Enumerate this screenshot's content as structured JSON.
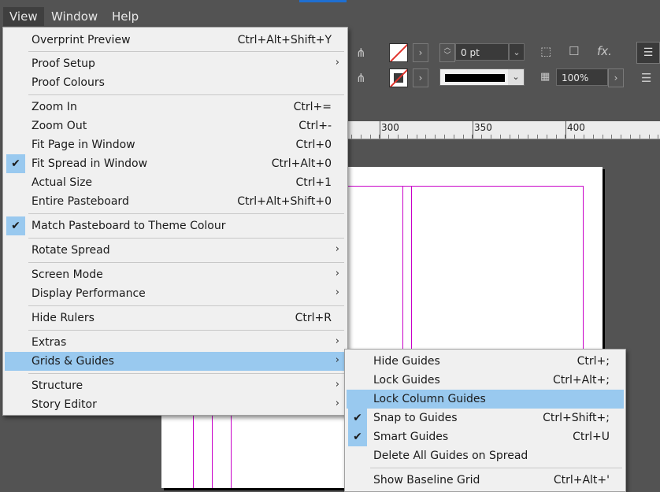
{
  "menubar": {
    "items": [
      "View",
      "Window",
      "Help"
    ]
  },
  "control_bar": {
    "stroke_weight": "0 pt",
    "opacity": "100%"
  },
  "ruler": {
    "labels": [
      "300",
      "350",
      "400"
    ]
  },
  "view_menu": {
    "items": [
      {
        "label": "Overprint Preview",
        "shortcut": "Ctrl+Alt+Shift+Y"
      },
      {
        "label": "Proof Setup",
        "submenu": true
      },
      {
        "label": "Proof Colours"
      },
      {
        "label": "Zoom In",
        "shortcut": "Ctrl+="
      },
      {
        "label": "Zoom Out",
        "shortcut": "Ctrl+-"
      },
      {
        "label": "Fit Page in Window",
        "shortcut": "Ctrl+0"
      },
      {
        "label": "Fit Spread in Window",
        "shortcut": "Ctrl+Alt+0",
        "checked": true
      },
      {
        "label": "Actual Size",
        "shortcut": "Ctrl+1"
      },
      {
        "label": "Entire Pasteboard",
        "shortcut": "Ctrl+Alt+Shift+0"
      },
      {
        "label": "Match Pasteboard to Theme Colour",
        "checked": true
      },
      {
        "label": "Rotate Spread",
        "submenu": true
      },
      {
        "label": "Screen Mode",
        "submenu": true
      },
      {
        "label": "Display Performance",
        "submenu": true
      },
      {
        "label": "Hide Rulers",
        "shortcut": "Ctrl+R"
      },
      {
        "label": "Extras",
        "submenu": true
      },
      {
        "label": "Grids & Guides",
        "submenu": true,
        "highlighted": true
      },
      {
        "label": "Structure",
        "submenu": true
      },
      {
        "label": "Story Editor",
        "submenu": true
      }
    ]
  },
  "guides_submenu": {
    "items": [
      {
        "label": "Hide Guides",
        "shortcut": "Ctrl+;"
      },
      {
        "label": "Lock Guides",
        "shortcut": "Ctrl+Alt+;"
      },
      {
        "label": "Lock Column Guides",
        "highlighted": true
      },
      {
        "label": "Snap to Guides",
        "shortcut": "Ctrl+Shift+;",
        "checked": true
      },
      {
        "label": "Smart Guides",
        "shortcut": "Ctrl+U",
        "checked": true
      },
      {
        "label": "Delete All Guides on Spread"
      },
      {
        "label": "Show Baseline Grid",
        "shortcut": "Ctrl+Alt+'"
      }
    ]
  },
  "icons": {
    "checkmark": "checkmark-icon",
    "submenu_arrow": "chevron-right-icon"
  },
  "colors": {
    "highlight": "#99c9ef",
    "guide": "#c800c8",
    "stroke_none": "#e0322b"
  }
}
